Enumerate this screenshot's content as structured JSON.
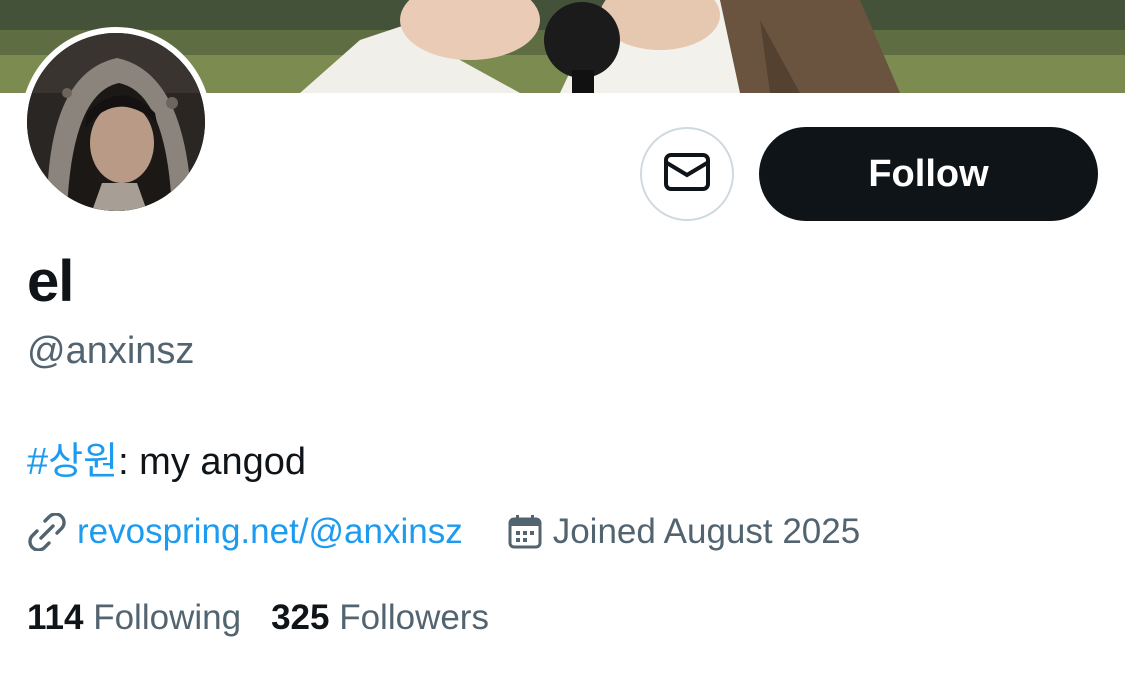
{
  "profile": {
    "display_name": "el",
    "handle": "@anxinsz",
    "bio_hashtag": "#상원",
    "bio_text": ": my angod",
    "website": "revospring.net/@anxinsz",
    "joined": "Joined August 2025",
    "following_count": "114",
    "following_label": "Following",
    "followers_count": "325",
    "followers_label": "Followers"
  },
  "actions": {
    "follow_label": "Follow",
    "message_icon": "envelope-icon"
  },
  "icons": {
    "link": "link-icon",
    "calendar": "calendar-icon"
  },
  "colors": {
    "accent": "#1d9bf0",
    "primary_text": "#0f1419",
    "secondary_text": "#536471",
    "button_bg": "#0f1419",
    "border": "#cfd9de"
  }
}
